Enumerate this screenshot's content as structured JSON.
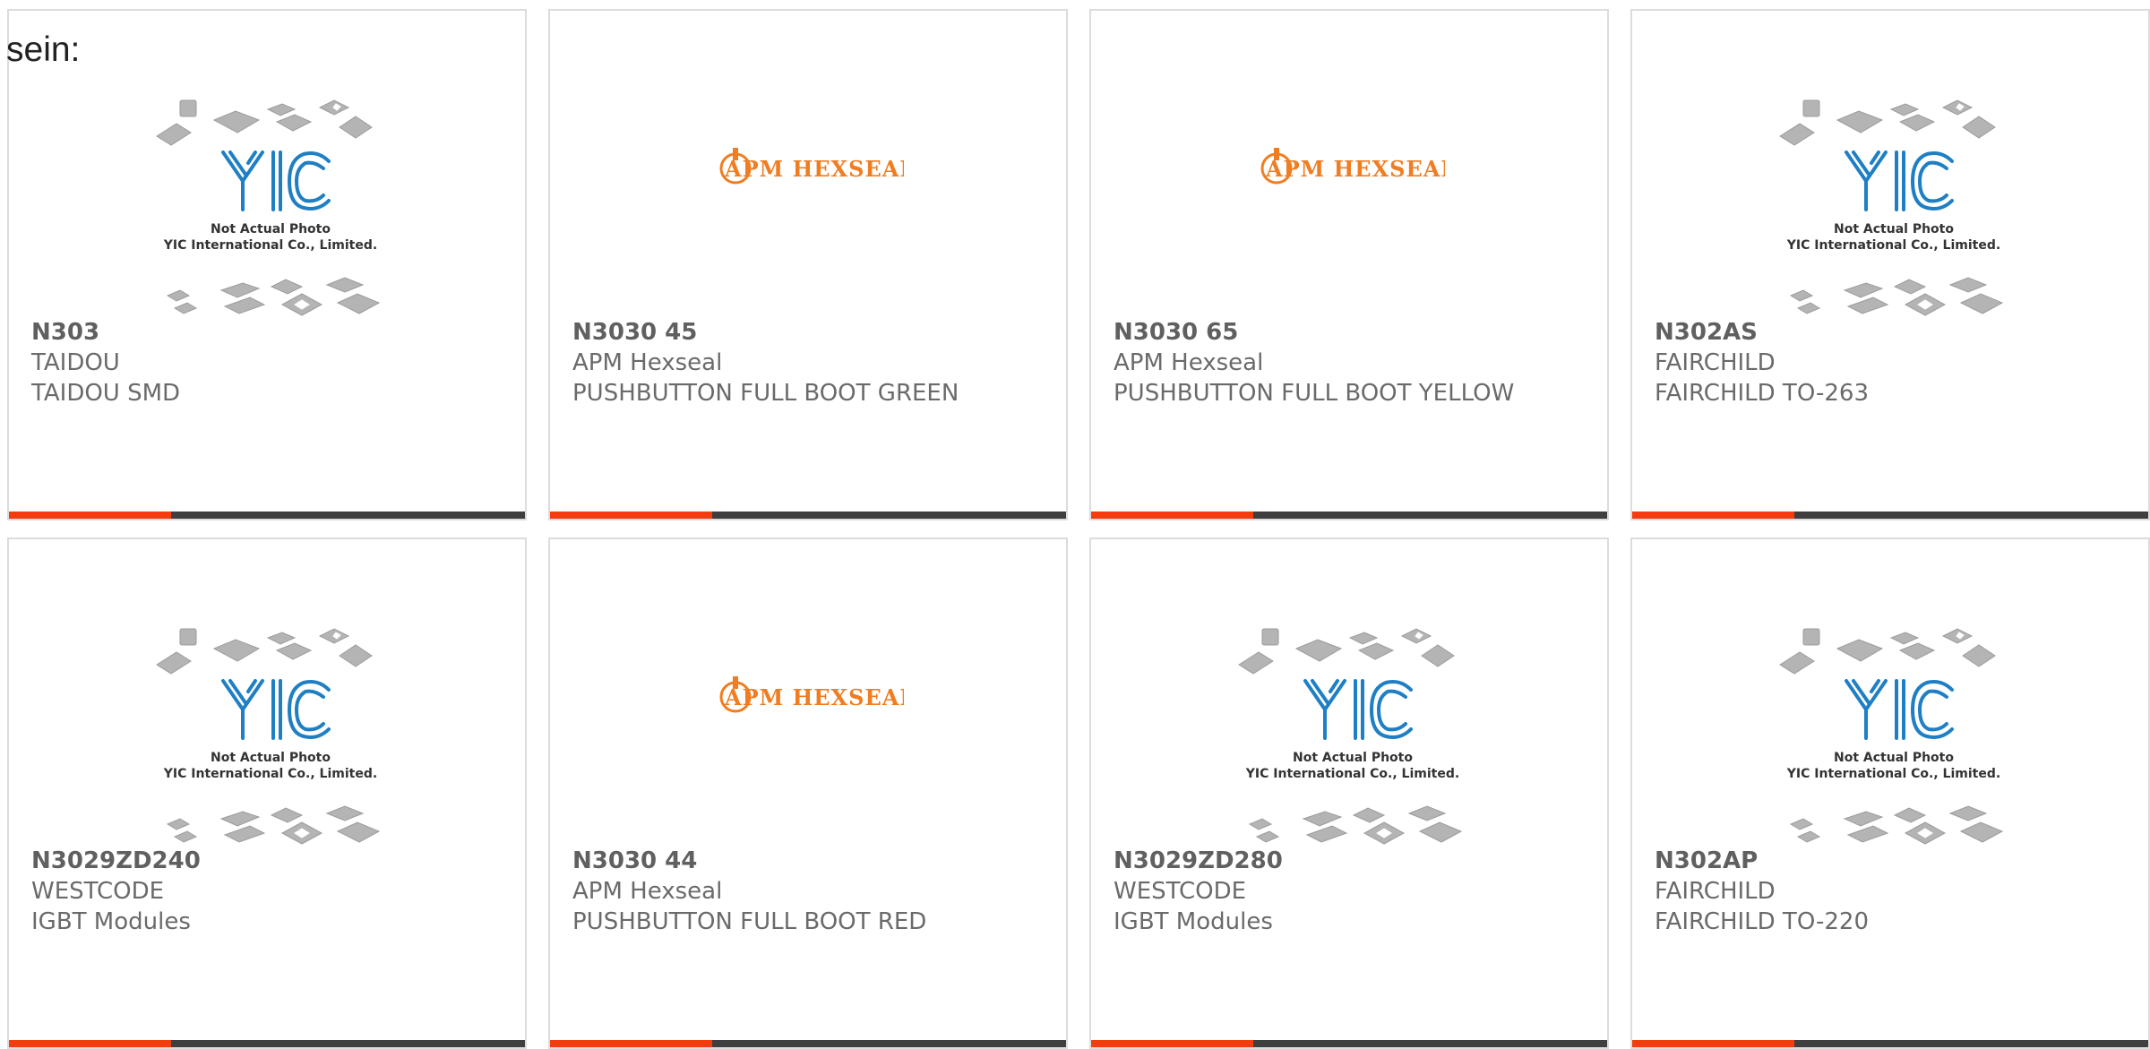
{
  "page_prefix": "sein:",
  "colors": {
    "accent": "#f53c0e",
    "accent_rest": "#3f3f3f",
    "yic_blue": "#1f7fc4",
    "apm_orange": "#ef7d22"
  },
  "thumbnails": {
    "yic": {
      "line1": "Not Actual Photo",
      "line2": "YIC International Co., Limited.",
      "logo": "YIC"
    },
    "apm": {
      "logo": "APM HEXSEAL"
    }
  },
  "cards": [
    {
      "part": "N303",
      "maker": "TAIDOU",
      "desc": "TAIDOU SMD",
      "image": "yic"
    },
    {
      "part": "N3030 45",
      "maker": "APM Hexseal",
      "desc": "PUSHBUTTON FULL BOOT GREEN",
      "image": "apm"
    },
    {
      "part": "N3030 65",
      "maker": "APM Hexseal",
      "desc": "PUSHBUTTON FULL BOOT YELLOW",
      "image": "apm"
    },
    {
      "part": "N302AS",
      "maker": "FAIRCHILD",
      "desc": "FAIRCHILD TO-263",
      "image": "yic"
    },
    {
      "part": "N3029ZD240",
      "maker": "WESTCODE",
      "desc": "IGBT Modules",
      "image": "yic"
    },
    {
      "part": "N3030 44",
      "maker": "APM Hexseal",
      "desc": "PUSHBUTTON FULL BOOT RED",
      "image": "apm"
    },
    {
      "part": "N3029ZD280",
      "maker": "WESTCODE",
      "desc": "IGBT Modules",
      "image": "yic"
    },
    {
      "part": "N302AP",
      "maker": "FAIRCHILD",
      "desc": "FAIRCHILD TO-220",
      "image": "yic"
    }
  ]
}
